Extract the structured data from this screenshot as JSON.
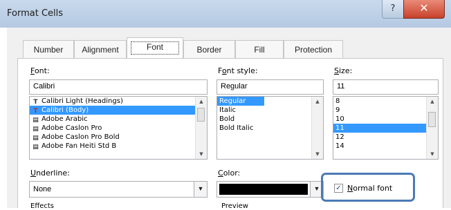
{
  "window": {
    "title": "Format Cells",
    "help_glyph": "?",
    "close_glyph": "✕"
  },
  "tabs": [
    {
      "label": "Number"
    },
    {
      "label": "Alignment"
    },
    {
      "label": "Font",
      "active": true
    },
    {
      "label": "Border"
    },
    {
      "label": "Fill"
    },
    {
      "label": "Protection"
    }
  ],
  "font": {
    "label_prefix": "F",
    "label_rest": "ont:",
    "value": "Calibri",
    "items": [
      {
        "icon": "T",
        "label": "Calibri Light (Headings)"
      },
      {
        "icon": "T",
        "label": "Calibri (Body)",
        "selected": true
      },
      {
        "icon": "doc",
        "label": "Adobe Arabic"
      },
      {
        "icon": "doc",
        "label": "Adobe Caslon Pro"
      },
      {
        "icon": "doc",
        "label": "Adobe Caslon Pro Bold"
      },
      {
        "icon": "doc",
        "label": "Adobe Fan Heiti Std B"
      }
    ]
  },
  "font_style": {
    "label_pre": "F",
    "label_u": "o",
    "label_rest": "nt style:",
    "value": "Regular",
    "items": [
      {
        "label": "Regular",
        "selected": true
      },
      {
        "label": "Italic"
      },
      {
        "label": "Bold"
      },
      {
        "label": "Bold Italic"
      }
    ]
  },
  "size": {
    "label_u": "S",
    "label_rest": "ize:",
    "value": "11",
    "items": [
      {
        "label": "8"
      },
      {
        "label": "9"
      },
      {
        "label": "10"
      },
      {
        "label": "11",
        "selected": true
      },
      {
        "label": "12"
      },
      {
        "label": "14"
      }
    ]
  },
  "underline": {
    "label_u": "U",
    "label_rest": "nderline:",
    "value": "None"
  },
  "color": {
    "label_u": "C",
    "label_rest": "olor:",
    "swatch": "#000000"
  },
  "normal_font": {
    "label_u": "N",
    "label_rest": "ormal font",
    "checked": true
  },
  "effects": {
    "label": "Effects"
  },
  "preview": {
    "label": "Preview"
  },
  "colors": {
    "highlight": "#4a7ab5",
    "selection": "#3399ff",
    "close": "#c8412a"
  }
}
